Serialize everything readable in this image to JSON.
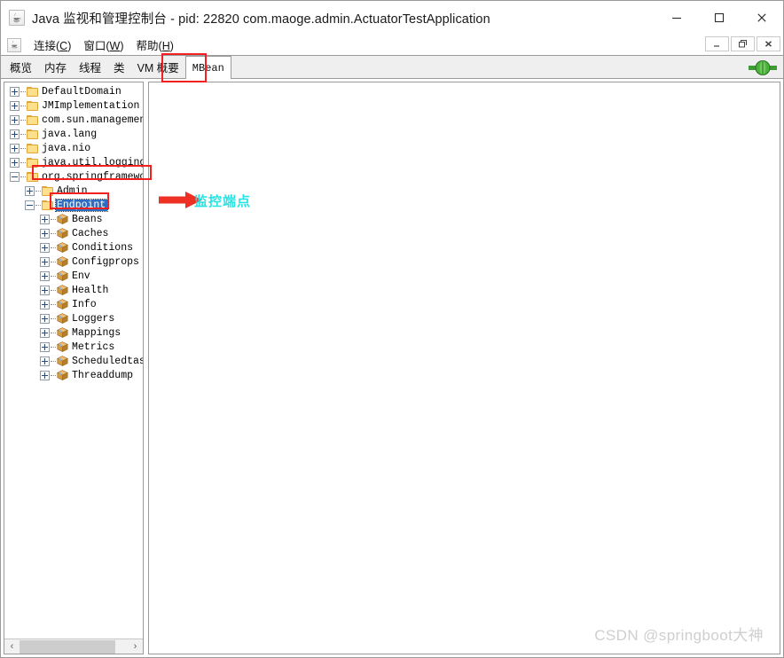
{
  "window": {
    "title": "Java 监视和管理控制台 - pid: 22820 com.maoge.admin.ActuatorTestApplication",
    "app_icon": "java-cup-icon",
    "controls": {
      "minimize": "—",
      "maximize": "☐",
      "close": "✕"
    },
    "inner_controls": {
      "minimize": "_",
      "restore": "❐",
      "close": "✕"
    }
  },
  "menubar": {
    "icon": "java-cup-icon",
    "items": [
      {
        "label": "连接(C)",
        "mnemonic": "C"
      },
      {
        "label": "窗口(W)",
        "mnemonic": "W"
      },
      {
        "label": "帮助(H)",
        "mnemonic": "H"
      }
    ]
  },
  "tabs": {
    "items": [
      {
        "label": "概览",
        "selected": false
      },
      {
        "label": "内存",
        "selected": false
      },
      {
        "label": "线程",
        "selected": false
      },
      {
        "label": "类",
        "selected": false
      },
      {
        "label": "VM 概要",
        "selected": false
      },
      {
        "label": "MBean",
        "selected": true
      }
    ],
    "status_icon": "green-connected-plug-icon"
  },
  "tree": {
    "nodes": [
      {
        "label": "DefaultDomain",
        "indent": 0,
        "toggle": "plus",
        "icon": "folder-icon",
        "selected": false
      },
      {
        "label": "JMImplementation",
        "indent": 0,
        "toggle": "plus",
        "icon": "folder-icon",
        "selected": false
      },
      {
        "label": "com.sun.management",
        "indent": 0,
        "toggle": "plus",
        "icon": "folder-icon",
        "selected": false
      },
      {
        "label": "java.lang",
        "indent": 0,
        "toggle": "plus",
        "icon": "folder-icon",
        "selected": false
      },
      {
        "label": "java.nio",
        "indent": 0,
        "toggle": "plus",
        "icon": "folder-icon",
        "selected": false
      },
      {
        "label": "java.util.logging",
        "indent": 0,
        "toggle": "plus",
        "icon": "folder-icon",
        "selected": false
      },
      {
        "label": "org.springframework.",
        "indent": 0,
        "toggle": "minus",
        "icon": "folder-icon",
        "selected": false
      },
      {
        "label": "Admin",
        "indent": 1,
        "toggle": "plus",
        "icon": "folder-icon",
        "selected": false
      },
      {
        "label": "Endpoint",
        "indent": 1,
        "toggle": "minus",
        "icon": "folder-icon",
        "selected": true
      },
      {
        "label": "Beans",
        "indent": 2,
        "toggle": "plus",
        "icon": "mbean-icon",
        "selected": false
      },
      {
        "label": "Caches",
        "indent": 2,
        "toggle": "plus",
        "icon": "mbean-icon",
        "selected": false
      },
      {
        "label": "Conditions",
        "indent": 2,
        "toggle": "plus",
        "icon": "mbean-icon",
        "selected": false
      },
      {
        "label": "Configprops",
        "indent": 2,
        "toggle": "plus",
        "icon": "mbean-icon",
        "selected": false
      },
      {
        "label": "Env",
        "indent": 2,
        "toggle": "plus",
        "icon": "mbean-icon",
        "selected": false
      },
      {
        "label": "Health",
        "indent": 2,
        "toggle": "plus",
        "icon": "mbean-icon",
        "selected": false
      },
      {
        "label": "Info",
        "indent": 2,
        "toggle": "plus",
        "icon": "mbean-icon",
        "selected": false
      },
      {
        "label": "Loggers",
        "indent": 2,
        "toggle": "plus",
        "icon": "mbean-icon",
        "selected": false
      },
      {
        "label": "Mappings",
        "indent": 2,
        "toggle": "plus",
        "icon": "mbean-icon",
        "selected": false
      },
      {
        "label": "Metrics",
        "indent": 2,
        "toggle": "plus",
        "icon": "mbean-icon",
        "selected": false
      },
      {
        "label": "Scheduledtasks",
        "indent": 2,
        "toggle": "plus",
        "icon": "mbean-icon",
        "selected": false
      },
      {
        "label": "Threaddump",
        "indent": 2,
        "toggle": "plus",
        "icon": "mbean-icon",
        "selected": false
      }
    ],
    "hscroll": {
      "left_arrow": "‹",
      "right_arrow": "›"
    }
  },
  "annotations": {
    "callout_text": "监控端点",
    "box_color": "#f32020",
    "text_color": "#29e3e3",
    "arrow_color": "#ee3124"
  },
  "watermark": {
    "text": "CSDN @springboot大神",
    "color": "#cfcfcf"
  }
}
